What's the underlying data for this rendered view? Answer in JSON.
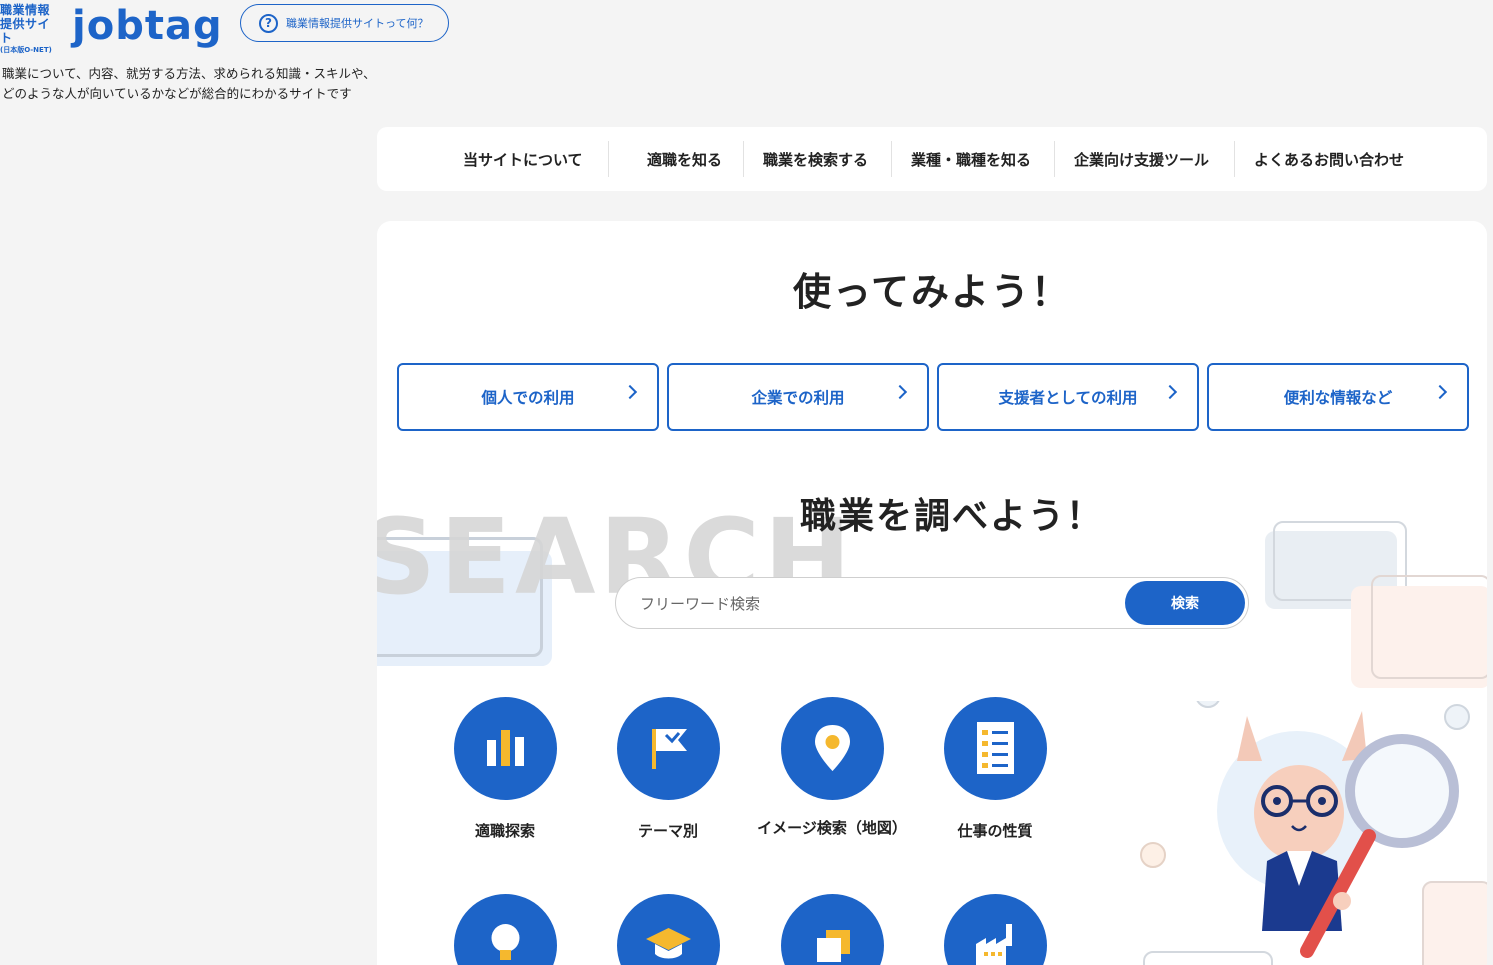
{
  "header": {
    "logo_line1": "職業情報",
    "logo_line2": "提供サイト",
    "logo_line3": "(日本版O-NET)",
    "logo_word": "jobtag",
    "about_pill": "職業情報提供サイトって何？",
    "tagline_line1": "職業について、内容、就労する方法、求められる知識・スキルや、",
    "tagline_line2": "どのような人が向いているかなどが総合的にわかるサイトです"
  },
  "nav": {
    "items": [
      {
        "label": "当サイトについて"
      },
      {
        "label": "適職を知る"
      },
      {
        "label": "職業を検索する"
      },
      {
        "label": "業種・職種を知る"
      },
      {
        "label": "企業向け支援ツール"
      },
      {
        "label": "よくあるお問い合わせ"
      }
    ]
  },
  "try_section": {
    "heading": "使ってみよう！",
    "buttons": [
      {
        "label": "個人での利用"
      },
      {
        "label": "企業での利用"
      },
      {
        "label": "支援者としての利用"
      },
      {
        "label": "便利な情報など"
      }
    ]
  },
  "search_section": {
    "bg_word": "SEARCH",
    "heading": "職業を調べよう！",
    "placeholder": "フリーワード検索",
    "button": "検索"
  },
  "features": [
    {
      "label": "適職探索",
      "icon": "bar-chart-icon"
    },
    {
      "label": "テーマ別",
      "icon": "flag-icon"
    },
    {
      "label": "イメージ検索（地図）",
      "icon": "map-pin-icon"
    },
    {
      "label": "仕事の性質",
      "icon": "checklist-icon"
    },
    {
      "label": "",
      "icon": "lightbulb-icon"
    },
    {
      "label": "",
      "icon": "graduation-cap-icon"
    },
    {
      "label": "",
      "icon": "cards-icon"
    },
    {
      "label": "",
      "icon": "factory-icon"
    }
  ],
  "colors": {
    "brand": "#1d64c8",
    "accent": "#f5b82e",
    "background": "#f4f4f4"
  }
}
